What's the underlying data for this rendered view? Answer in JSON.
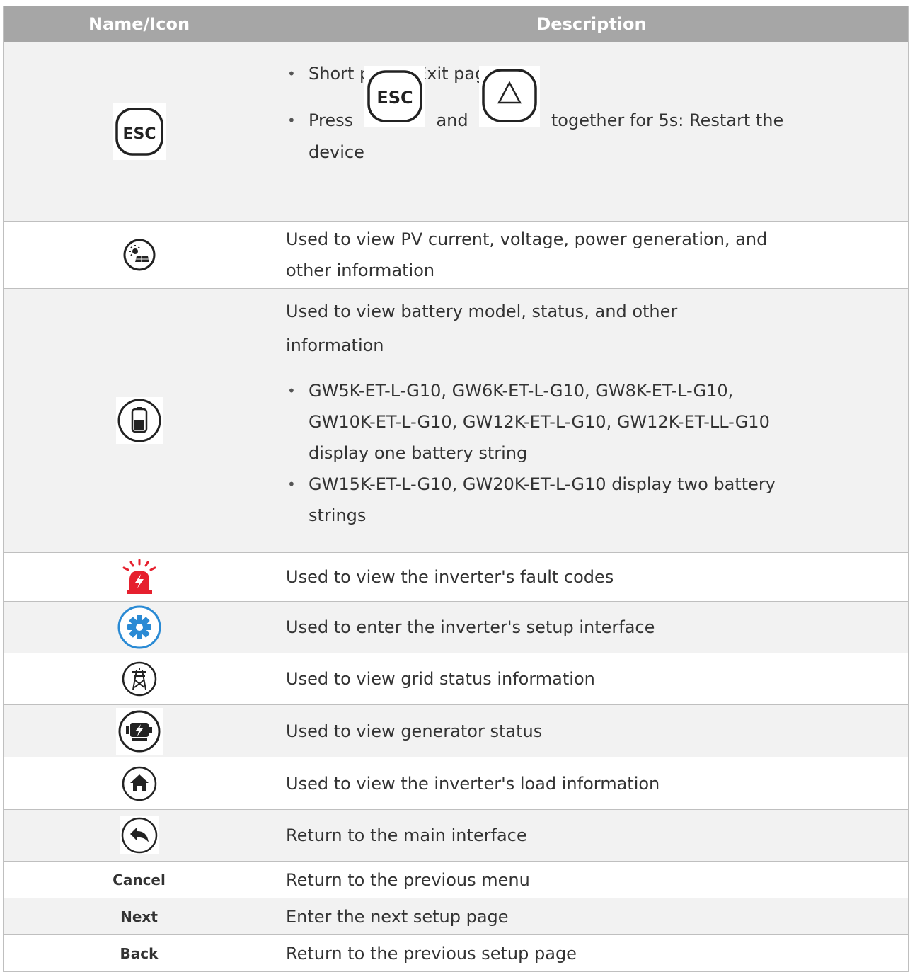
{
  "header": {
    "col1": "Name/Icon",
    "col2": "Description"
  },
  "rows": {
    "esc": {
      "icon": "esc-key-icon",
      "bullets": [
        "Short press: Exit page"
      ],
      "press_prefix": "Press",
      "press_and": "and",
      "press_suffix_line1": "together for 5s: Restart the",
      "press_suffix_line2": "device"
    },
    "pv": {
      "icon": "pv-sun-panel-icon",
      "line1": "Used to view PV current, voltage, power generation, and",
      "line2": "other information"
    },
    "battery": {
      "icon": "battery-icon",
      "line1": "Used to view battery model, status, and other",
      "line2": "information",
      "bullet1_l1": "GW5K-ET-L-G10, GW6K-ET-L-G10, GW8K-ET-L-G10,",
      "bullet1_l2": "GW10K-ET-L-G10, GW12K-ET-L-G10, GW12K-ET-LL-G10",
      "bullet1_l3": "display one battery string",
      "bullet2_l1": "GW15K-ET-L-G10, GW20K-ET-L-G10 display two battery",
      "bullet2_l2": "strings"
    },
    "fault": {
      "icon": "alarm-light-icon",
      "text": "Used to view the inverter's fault codes"
    },
    "setup": {
      "icon": "gear-icon",
      "text": "Used to enter the inverter's setup interface"
    },
    "grid": {
      "icon": "grid-tower-icon",
      "text": "Used to view grid status information"
    },
    "generator": {
      "icon": "generator-icon",
      "text": "Used to view generator status"
    },
    "load": {
      "icon": "home-icon",
      "text": "Used to view the inverter's load information"
    },
    "return": {
      "icon": "return-arrow-icon",
      "text": "Return to the main interface"
    },
    "cancel": {
      "label": "Cancel",
      "text": "Return to the previous menu"
    },
    "next": {
      "label": "Next",
      "text": "Enter the next setup page"
    },
    "back": {
      "label": "Back",
      "text": "Return to the previous setup page"
    }
  },
  "colors": {
    "header_bg": "#a6a6a6",
    "row_alt_bg": "#f2f2f2",
    "alarm_red": "#e6202e",
    "gear_blue": "#2a8ad4",
    "border": "#bfbfbf"
  }
}
